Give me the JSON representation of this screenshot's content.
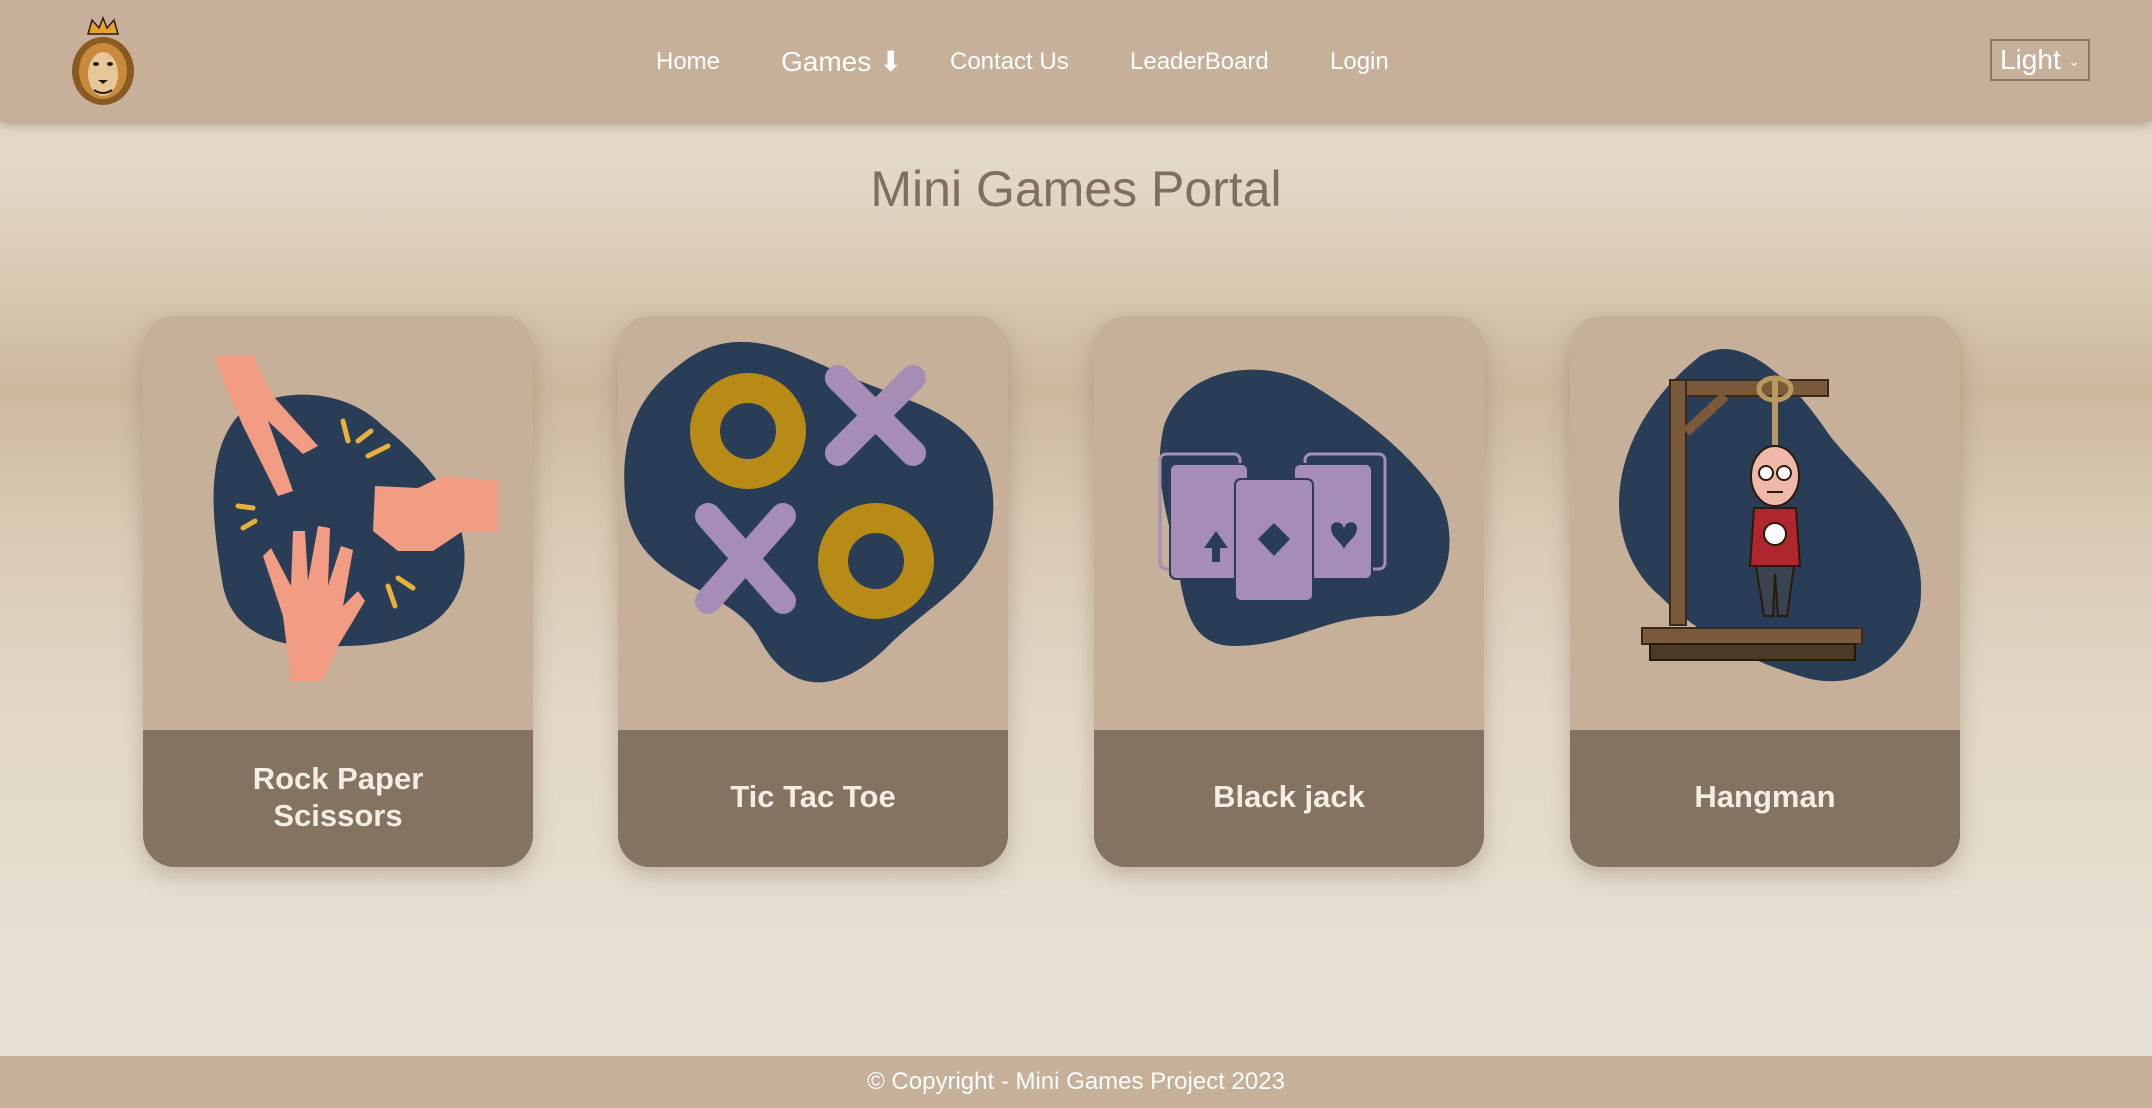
{
  "header": {
    "logo_icon": "lion-logo-icon",
    "nav": {
      "home": "Home",
      "games": "Games ⬇",
      "contact": "Contact Us",
      "leaderboard": "LeaderBoard",
      "login": "Login"
    },
    "theme_select": {
      "value": "Light",
      "icon": "chevron-down-icon"
    }
  },
  "main": {
    "title": "Mini Games Portal",
    "cards": [
      {
        "label": "Rock Paper Scissors",
        "icon": "rock-paper-scissors-icon"
      },
      {
        "label": "Tic Tac Toe",
        "icon": "tic-tac-toe-icon"
      },
      {
        "label": "Black jack",
        "icon": "playing-cards-icon"
      },
      {
        "label": "Hangman",
        "icon": "gallows-icon"
      }
    ]
  },
  "footer": {
    "copyright": "© Copyright - Mini Games Project 2023"
  },
  "colors": {
    "header_bg": "#c6b099",
    "card_footer_bg": "#847360",
    "blob": "#293d57",
    "purple": "#a68db6",
    "gold": "#b88a16",
    "skin": "#f29d83"
  }
}
